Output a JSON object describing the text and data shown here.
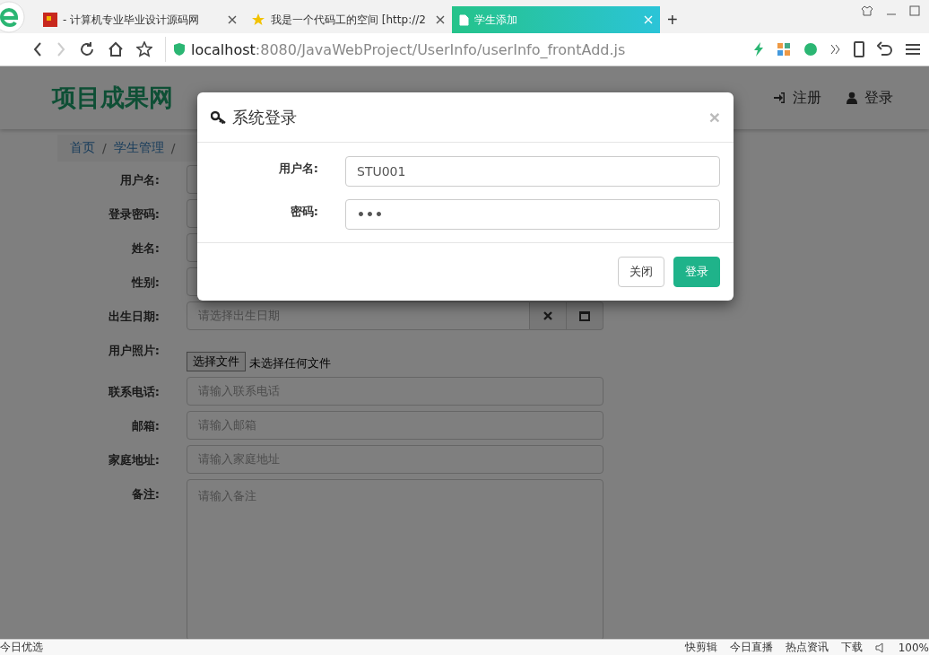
{
  "browser": {
    "tabs": [
      {
        "title": "- 计算机专业毕业设计源码网",
        "selected": false
      },
      {
        "title": "我是一个代码工的空间 [http://2",
        "selected": false
      },
      {
        "title": "学生添加",
        "selected": true
      }
    ],
    "new_tab": "+",
    "url": {
      "host": "localhost",
      "rest": ":8080/JavaWebProject/UserInfo/userInfo_frontAdd.js"
    }
  },
  "site": {
    "logo": "项目成果网",
    "nav_right": [
      {
        "label": "注册"
      },
      {
        "label": "登录"
      }
    ],
    "breadcrumb": [
      "首页",
      "学生管理"
    ],
    "breadcrumb_separator": "/"
  },
  "form": {
    "fields": [
      {
        "label": "用户名:",
        "kind": "text"
      },
      {
        "label": "登录密码:",
        "kind": "text"
      },
      {
        "label": "姓名:",
        "kind": "text"
      },
      {
        "label": "性别:",
        "kind": "text"
      },
      {
        "label": "出生日期:",
        "kind": "date",
        "placeholder": "请选择出生日期"
      },
      {
        "label": "用户照片:",
        "kind": "file",
        "button": "选择文件",
        "note": "未选择任何文件"
      },
      {
        "label": "联系电话:",
        "kind": "text",
        "placeholder": "请输入联系电话"
      },
      {
        "label": "邮箱:",
        "kind": "text",
        "placeholder": "请输入邮箱"
      },
      {
        "label": "家庭地址:",
        "kind": "text",
        "placeholder": "请输入家庭地址"
      },
      {
        "label": "备注:",
        "kind": "textarea",
        "placeholder": "请输入备注"
      }
    ]
  },
  "modal": {
    "title": "系统登录",
    "close": "×",
    "fields": [
      {
        "label": "用户名:",
        "value": "STU001",
        "kind": "text"
      },
      {
        "label": "密码:",
        "value": "•••",
        "kind": "password"
      }
    ],
    "buttons": [
      {
        "label": "关闭",
        "kind": "default"
      },
      {
        "label": "登录",
        "kind": "primary"
      }
    ]
  },
  "status_bar": {
    "left": "今日优选",
    "items": [
      "快剪辑",
      "今日直播",
      "热点资讯",
      "下载"
    ],
    "zoom": "100%"
  }
}
